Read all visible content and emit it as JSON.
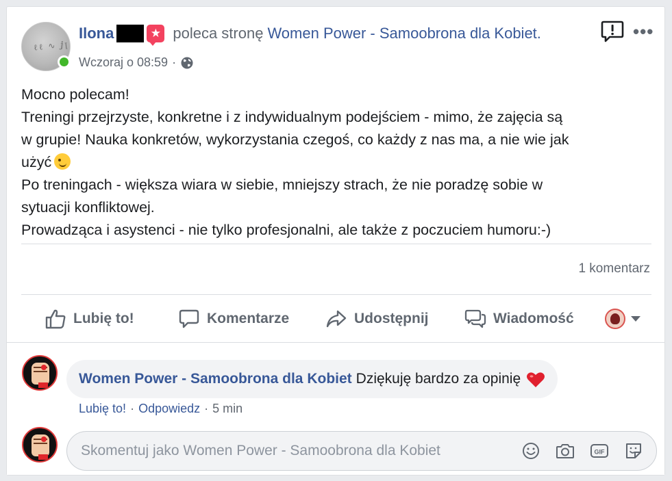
{
  "post": {
    "author": "Ilona",
    "recommends_text": "poleca stronę",
    "page_name": "Women Power - Samoobrona dla Kobiet.",
    "timestamp": "Wczoraj o 08:59",
    "separator": "·",
    "text_lines": [
      "Mocno polecam!",
      "Treningi przejrzyste, konkretne i z indywidualnym podejściem - mimo, że zajęcia są",
      "w grupie! Nauka konkretów, wykorzystania czegoś, co każdy z nas ma, a nie wie jak",
      "użyć",
      "Po treningach - większa wiara w siebie, mniejszy strach, że nie poradzę sobie w",
      "sytuacji konfliktowej.",
      "Prowadząca i asystenci - nie tylko profesjonalni, ale także z poczuciem humoru:-)"
    ],
    "comment_count": "1 komentarz"
  },
  "actions": {
    "like": "Lubię to!",
    "comment": "Komentarze",
    "share": "Udostępnij",
    "message": "Wiadomość"
  },
  "comment": {
    "author": "Women Power - Samoobrona dla Kobiet",
    "text": "Dziękuję bardzo za opinię",
    "like": "Lubię to!",
    "reply": "Odpowiedz",
    "time": "5 min",
    "separator": "·"
  },
  "composer": {
    "placeholder": "Skomentuj jako Women Power - Samoobrona dla Kobiet"
  },
  "icons": [
    "globe-icon",
    "report-icon",
    "more-icon",
    "like-icon",
    "comment-icon",
    "share-icon",
    "message-icon",
    "smiley-icon",
    "camera-icon",
    "gif-icon",
    "sticker-icon",
    "heart-emoji",
    "wink-emoji"
  ],
  "colors": {
    "link": "#385898",
    "secondary_text": "#606770",
    "online": "#42b72a",
    "badge": "#f3425f"
  }
}
